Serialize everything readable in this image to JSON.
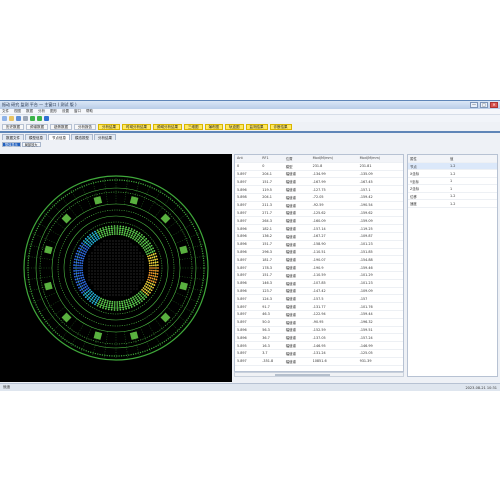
{
  "window": {
    "title": "振动 研究 监测 平台 — 主窗口 ( 测试 版 )",
    "minimize_label": "—",
    "maximize_label": "□",
    "close_label": "✕"
  },
  "menu": [
    "文件",
    "视图",
    "数据",
    "分析",
    "图形",
    "设置",
    "窗口",
    "帮助"
  ],
  "toolbar_icons": [
    {
      "name": "new-icon",
      "color": "#8fb3e8"
    },
    {
      "name": "open-icon",
      "color": "#e8c463"
    },
    {
      "name": "save-icon",
      "color": "#5e8fd6"
    },
    {
      "name": "print-icon",
      "color": "#9aa5b5"
    },
    {
      "name": "run-icon",
      "color": "#3cb34a"
    },
    {
      "name": "stop-icon",
      "color": "#3cb34a"
    },
    {
      "name": "settings-icon",
      "color": "#2f6fd2"
    }
  ],
  "function_buttons": [
    {
      "label": "历史数据",
      "style": "plain"
    },
    {
      "label": "频谱数据",
      "style": "plain"
    },
    {
      "label": "趋势数据",
      "style": "plain"
    },
    {
      "label": "分析报告",
      "style": "plain"
    },
    {
      "label": "分析结果",
      "style": "yellow"
    },
    {
      "label": "时域分析结果",
      "style": "yellow"
    },
    {
      "label": "频域分析结果",
      "style": "yellow"
    },
    {
      "label": "三维图",
      "style": "yellow"
    },
    {
      "label": "瀑布图",
      "style": "yellow"
    },
    {
      "label": "轨迹图",
      "style": "yellow"
    },
    {
      "label": "监测结果",
      "style": "yellow"
    },
    {
      "label": "诊断结果",
      "style": "yellow"
    }
  ],
  "tabs": [
    "数据文件",
    "模型信息",
    "节点信息",
    "模态振型",
    "分析结果"
  ],
  "active_tab": 2,
  "subtabs": [
    "整体显示",
    "局部放大"
  ],
  "active_subtab": 0,
  "table": {
    "columns": [
      "Ant",
      "RF1",
      "位置",
      "Mod(M/mm)",
      "Mod(M/mm)"
    ],
    "rows": [
      [
        "0",
        "0",
        "模型",
        "231.8",
        "231.81"
      ],
      [
        "5.897",
        "204.1",
        "幅值谱",
        "-134.99",
        "-135.09"
      ],
      [
        "5.897",
        "151.7",
        "幅值谱",
        "-167.99",
        "-167.45"
      ],
      [
        "5.896",
        "119.5",
        "幅值谱",
        "-127.75",
        "-157.1"
      ],
      [
        "5.898",
        "204.1",
        "幅值谱",
        "-72.05",
        "-159.42"
      ],
      [
        "5.897",
        "211.3",
        "幅值谱",
        "-92.59",
        "-190.54"
      ],
      [
        "5.897",
        "271.7",
        "幅值谱",
        "-125.62",
        "-159.62"
      ],
      [
        "5.897",
        "264.3",
        "幅值谱",
        "-160.09",
        "-159.09"
      ],
      [
        "5.896",
        "182.1",
        "幅值谱",
        "-157.14",
        "-119.25"
      ],
      [
        "5.896",
        "136.2",
        "幅值谱",
        "-167.27",
        "-109.87"
      ],
      [
        "5.896",
        "151.7",
        "幅值谱",
        "-158.90",
        "-101.23"
      ],
      [
        "5.896",
        "296.3",
        "幅值谱",
        "-110.51",
        "-151.85"
      ],
      [
        "5.897",
        "181.7",
        "幅值谱",
        "-190.07",
        "-154.88"
      ],
      [
        "5.897",
        "178.3",
        "幅值谱",
        "-190.9",
        "-159.46"
      ],
      [
        "5.897",
        "151.7",
        "幅值谱",
        "-110.59",
        "-101.29"
      ],
      [
        "5.896",
        "146.3",
        "幅值谱",
        "-107.85",
        "-101.23"
      ],
      [
        "5.896",
        "123.7",
        "幅值谱",
        "-147.42",
        "-109.09"
      ],
      [
        "5.897",
        "124.3",
        "幅值谱",
        "-157.5",
        "-157"
      ],
      [
        "5.897",
        "91.7",
        "幅值谱",
        "-131.77",
        "-101.76"
      ],
      [
        "5.897",
        "46.3",
        "幅值谱",
        "-122.94",
        "-159.44"
      ],
      [
        "5.897",
        "50.0",
        "幅值谱",
        "-90.95",
        "-196.32"
      ],
      [
        "5.896",
        "56.3",
        "幅值谱",
        "-152.59",
        "-159.51"
      ],
      [
        "5.896",
        "36.7",
        "幅值谱",
        "-137.05",
        "-157.24"
      ],
      [
        "5.895",
        "16.3",
        "幅值谱",
        "-146.95",
        "-146.99"
      ],
      [
        "5.897",
        "3.7",
        "幅值谱",
        "-131.24",
        "-125.05"
      ],
      [
        "5.897",
        "-351.8",
        "幅值谱",
        "10851.6",
        "931.39"
      ]
    ]
  },
  "properties": {
    "columns": [
      "属性",
      "值"
    ],
    "rows": [
      [
        "节点",
        "1.2"
      ],
      [
        "X坐标",
        "1.2"
      ],
      [
        "Y坐标",
        "1"
      ],
      [
        "Z坐标",
        "1"
      ],
      [
        "位移",
        "1.2"
      ],
      [
        "速度",
        "1.2"
      ]
    ],
    "selected_row": 0
  },
  "status": {
    "left": "就绪",
    "right": "2023-08-21 10:31"
  }
}
